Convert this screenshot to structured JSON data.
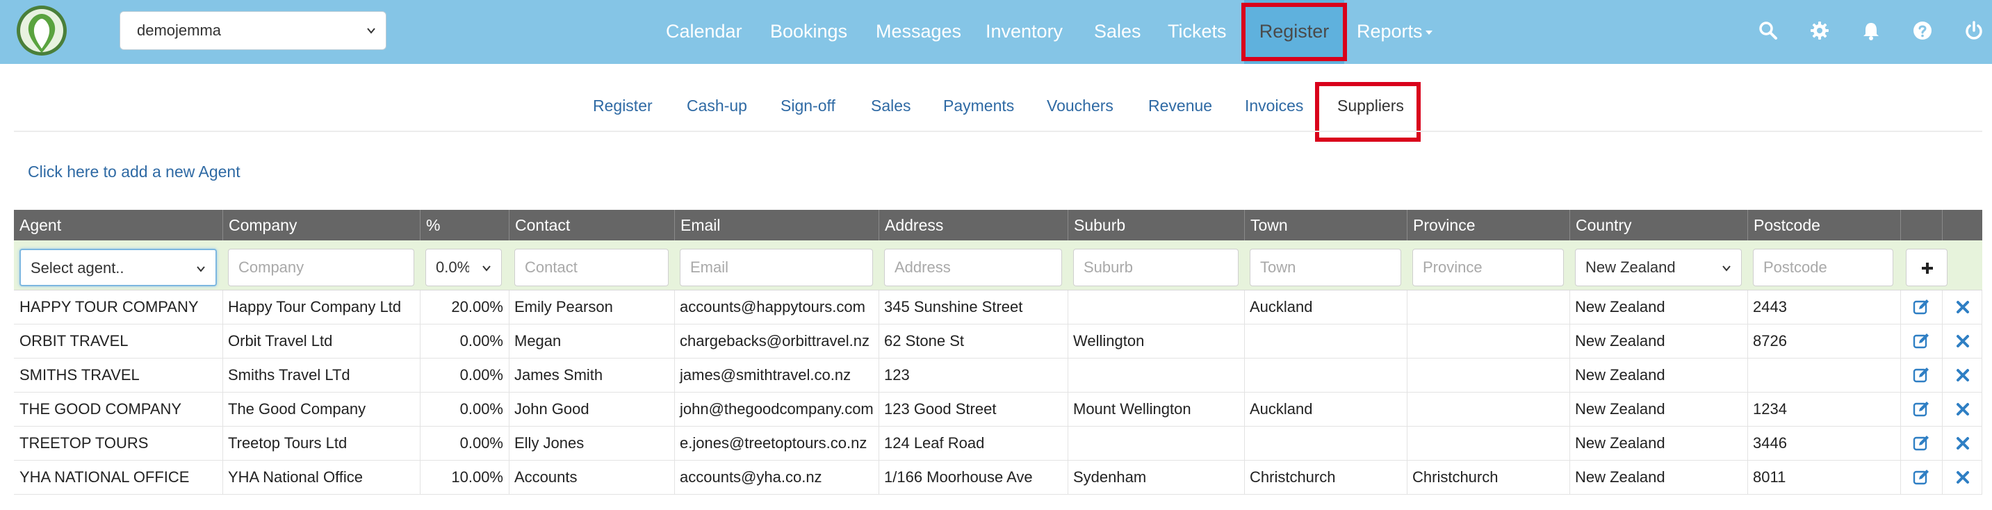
{
  "navbar": {
    "site_select": "demojemma",
    "links": [
      "Calendar",
      "Bookings",
      "Messages",
      "Inventory",
      "Sales",
      "Tickets",
      "Register",
      "Reports"
    ],
    "active": "Register"
  },
  "subnav": {
    "links": [
      "Register",
      "Cash-up",
      "Sign-off",
      "Sales",
      "Payments",
      "Vouchers",
      "Revenue",
      "Invoices",
      "Suppliers"
    ],
    "active": "Suppliers"
  },
  "add_agent_link": "Click here to add a new Agent",
  "table": {
    "headers": [
      "Agent",
      "Company",
      "%",
      "Contact",
      "Email",
      "Address",
      "Suburb",
      "Town",
      "Province",
      "Country",
      "Postcode"
    ],
    "filters": {
      "agent": "Select agent..",
      "company": "Company",
      "percent": "0.0%",
      "contact": "Contact",
      "email": "Email",
      "address": "Address",
      "suburb": "Suburb",
      "town": "Town",
      "province": "Province",
      "country": "New Zealand",
      "postcode": "Postcode"
    },
    "rows": [
      [
        "HAPPY TOUR COMPANY",
        "Happy Tour Company Ltd",
        "20.00%",
        "Emily Pearson",
        "accounts@happytours.com",
        "345 Sunshine Street",
        "",
        "Auckland",
        "",
        "New Zealand",
        "2443"
      ],
      [
        "ORBIT TRAVEL",
        "Orbit Travel Ltd",
        "0.00%",
        "Megan",
        "chargebacks@orbittravel.nz",
        "62 Stone St",
        "Wellington",
        "",
        "",
        "New Zealand",
        "8726"
      ],
      [
        "SMITHS TRAVEL",
        "Smiths Travel LTd",
        "0.00%",
        "James Smith",
        "james@smithtravel.co.nz",
        "123",
        "",
        "",
        "",
        "New Zealand",
        ""
      ],
      [
        "THE GOOD COMPANY",
        "The Good Company",
        "0.00%",
        "John Good",
        "john@thegoodcompany.com",
        "123 Good Street",
        "Mount Wellington",
        "Auckland",
        "",
        "New Zealand",
        "1234"
      ],
      [
        "TREETOP TOURS",
        "Treetop Tours Ltd",
        "0.00%",
        "Elly Jones",
        "e.jones@treetoptours.co.nz",
        "124 Leaf Road",
        "",
        "",
        "",
        "New Zealand",
        "3446"
      ],
      [
        "YHA NATIONAL OFFICE",
        "YHA National Office",
        "10.00%",
        "Accounts",
        "accounts@yha.co.nz",
        "1/166 Moorhouse Ave",
        "Sydenham",
        "Christchurch",
        "Christchurch",
        "New Zealand",
        "8011"
      ]
    ]
  },
  "colors": {
    "navbar": "#85c5e6",
    "link": "#2f6aa4",
    "header": "#666666",
    "filter_row": "#e7f3dc",
    "highlight": "#d9001b"
  },
  "icons": [
    "logo-icon",
    "search-icon",
    "gear-icon",
    "bell-icon",
    "help-icon",
    "power-icon",
    "chevron-down-icon",
    "plus-icon",
    "edit-icon",
    "delete-icon"
  ]
}
